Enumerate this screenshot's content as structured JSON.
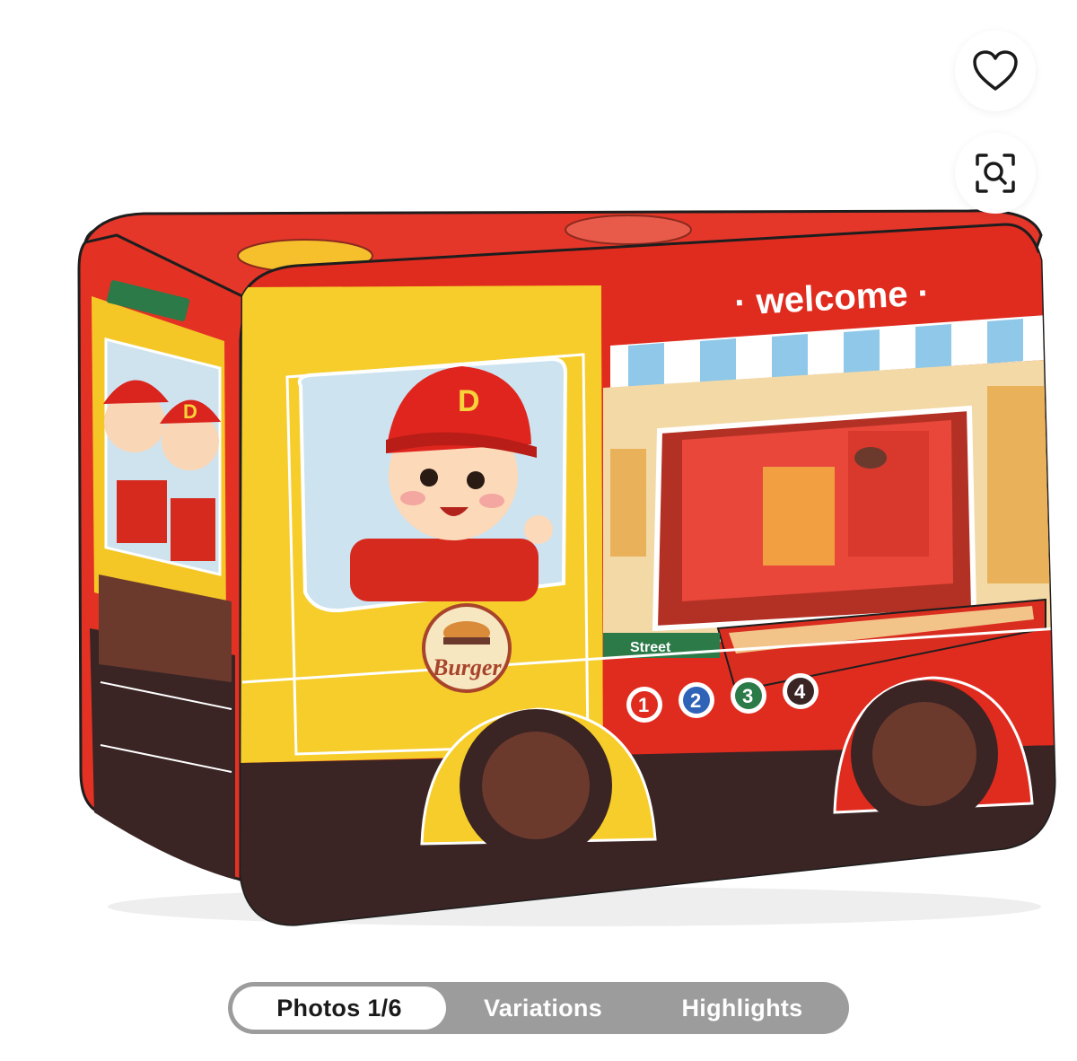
{
  "product": {
    "image_alt": "Burger food truck play tent"
  },
  "artwork_text": {
    "welcome": "· welcome ·",
    "cap_letter": "D",
    "badge_word": "Burger",
    "street": "Street",
    "numbers": [
      "1",
      "2",
      "3",
      "4"
    ]
  },
  "actions": {
    "wishlist_icon": "heart-outline-icon",
    "visual_search_icon": "image-search-icon"
  },
  "gallery_tabs": [
    {
      "label": "Photos 1/6",
      "active": true
    },
    {
      "label": "Variations",
      "active": false
    },
    {
      "label": "Highlights",
      "active": false
    }
  ],
  "colors": {
    "tent_red": "#e02b1f",
    "tent_yellow": "#f6cd2a",
    "tab_bg": "#9c9c9c",
    "tab_active_bg": "#ffffff"
  }
}
